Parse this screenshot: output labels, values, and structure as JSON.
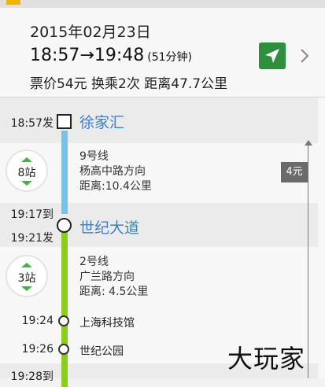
{
  "summary": {
    "date": "2015年02月23日",
    "depart": "18:57",
    "arrow": "→",
    "arrive": "19:48",
    "duration": "(51分钟)",
    "info": "票价54元 换乘2次 距离47.7公里"
  },
  "icons": {
    "navigate": "navigation-arrow-icon",
    "detail": "chevron-right-icon",
    "origin": "square-icon",
    "transfer": "circle-icon",
    "expand": "up-down-arrows-icon"
  },
  "colors": {
    "line9": "#7dc0e4",
    "line2": "#8ccc1d",
    "station_link": "#3d7fc8",
    "nav_button": "#2f8f3d"
  },
  "route": {
    "origin": {
      "time": "18:57发",
      "station": "徐家汇"
    },
    "seg1": {
      "stops": "8站",
      "line": "9号线",
      "direction": "杨高中路方向",
      "distance": "距离:10.4公里"
    },
    "fare": "4元",
    "transfer1": {
      "arrive": "19:17到",
      "depart": "19:21发",
      "station": "世纪大道"
    },
    "seg2": {
      "stops": "3站",
      "line": "2号线",
      "direction": "广兰路方向",
      "distance": "距离: 4.5公里"
    },
    "stops": [
      {
        "time": "19:24",
        "name": "上海科技馆"
      },
      {
        "time": "19:26",
        "name": "世纪公园"
      }
    ],
    "next_arrive": "19:28到"
  },
  "watermark": "大玩家"
}
